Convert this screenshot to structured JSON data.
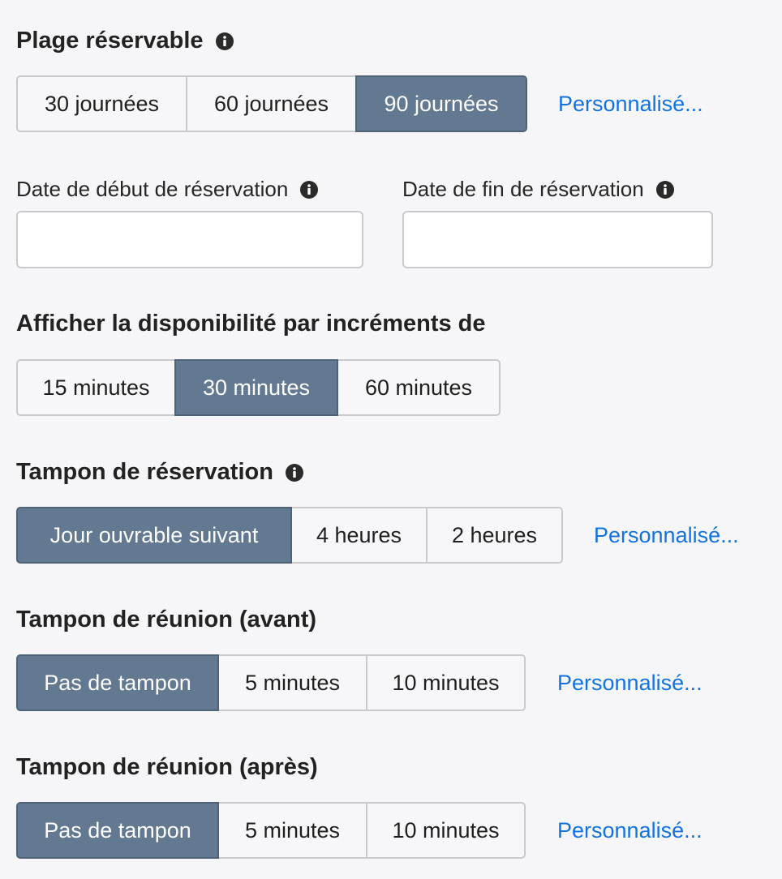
{
  "bookable_range": {
    "label": "Plage réservable",
    "icon": "info-icon",
    "options": [
      "30 journées",
      "60 journées",
      "90 journées"
    ],
    "selected_index": 2,
    "custom_link": "Personnalisé..."
  },
  "booking_start": {
    "label": "Date de début de réservation",
    "icon": "info-icon",
    "value": ""
  },
  "booking_end": {
    "label": "Date de fin de réservation",
    "icon": "info-icon",
    "value": ""
  },
  "increments": {
    "label": "Afficher la disponibilité par incréments de",
    "options": [
      "15 minutes",
      "30 minutes",
      "60 minutes"
    ],
    "selected_index": 1
  },
  "booking_buffer": {
    "label": "Tampon de réservation",
    "icon": "info-icon",
    "options": [
      "Jour ouvrable suivant",
      "4 heures",
      "2 heures"
    ],
    "selected_index": 0,
    "custom_link": "Personnalisé..."
  },
  "meeting_buffer_before": {
    "label": "Tampon de réunion (avant)",
    "options": [
      "Pas de tampon",
      "5 minutes",
      "10 minutes"
    ],
    "selected_index": 0,
    "custom_link": "Personnalisé..."
  },
  "meeting_buffer_after": {
    "label": "Tampon de réunion (après)",
    "options": [
      "Pas de tampon",
      "5 minutes",
      "10 minutes"
    ],
    "selected_index": 0,
    "custom_link": "Personnalisé..."
  },
  "colors": {
    "selected_bg": "#637992",
    "link": "#1273e0",
    "page_bg": "#f6f6f8"
  }
}
